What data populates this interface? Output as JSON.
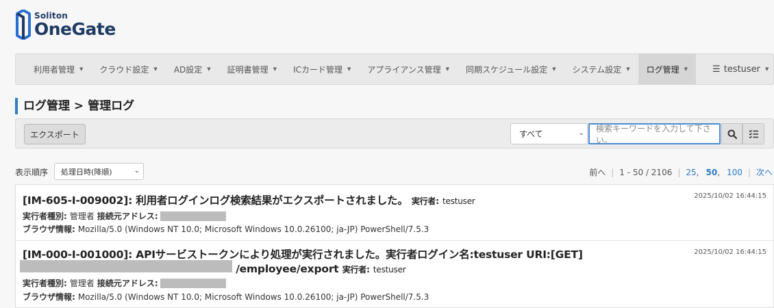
{
  "logo": {
    "brand_small": "Soliton",
    "brand_big": "OneGate"
  },
  "nav": {
    "items": [
      {
        "label": "利用者管理"
      },
      {
        "label": "クラウド設定"
      },
      {
        "label": "AD設定"
      },
      {
        "label": "証明書管理"
      },
      {
        "label": "ICカード管理"
      },
      {
        "label": "アプライアンス管理"
      },
      {
        "label": "同期スケジュール設定"
      },
      {
        "label": "システム設定"
      },
      {
        "label": "ログ管理",
        "active": true
      }
    ],
    "user_label": "testuser"
  },
  "page_title": "ログ管理 > 管理ログ",
  "toolbar": {
    "export_label": "エクスポート",
    "scope_value": "すべて",
    "search_placeholder": "検索キーワードを入力して下さい。"
  },
  "sort": {
    "label": "表示順序",
    "value": "処理日時(降順)"
  },
  "pager": {
    "prev": "前へ",
    "range": "1 - 50 / 2106",
    "size_25": "25",
    "size_50": "50",
    "size_100": "100",
    "next": "次へ"
  },
  "logs": [
    {
      "title": "[IM-605-I-009002]: 利用者ログインログ検索結果がエクスポートされました。",
      "by_label": "実行者:",
      "by_value": "testuser",
      "time": "2025/10/02 16:44:15",
      "kind_label": "実行者種別:",
      "kind_value": "管理者",
      "addr_label": "接続元アドレス:",
      "browser_label": "ブラウザ情報:",
      "browser_value": "Mozilla/5.0 (Windows NT 10.0; Microsoft Windows 10.0.26100; ja-JP) PowerShell/7.5.3"
    },
    {
      "title": "[IM-000-I-001000]: APIサービストークンにより処理が実行されました。実行者ログイン名:testuser URI:[GET]",
      "title_cont": "/employee/export",
      "by_label": "実行者:",
      "by_value": "testuser",
      "time": "2025/10/02 16:44:15",
      "kind_label": "実行者種別:",
      "kind_value": "管理者",
      "addr_label": "接続元アドレス:",
      "browser_label": "ブラウザ情報:",
      "browser_value": "Mozilla/5.0 (Windows NT 10.0; Microsoft Windows 10.0.26100; ja-JP) PowerShell/7.5.3"
    }
  ]
}
